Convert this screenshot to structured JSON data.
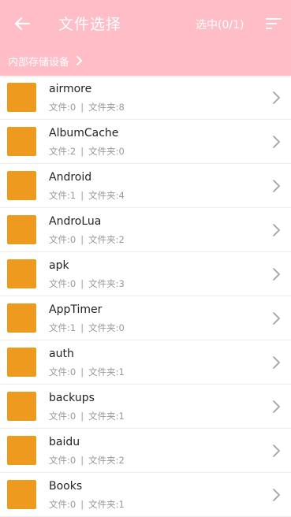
{
  "header": {
    "title": "文件选择",
    "selected": "选中(0/1)",
    "breadcrumb": "内部存储设备",
    "bg_color": "#ffbdc8"
  },
  "folders": [
    {
      "name": "airmore",
      "files_label": "文件:0",
      "sep": "|",
      "dirs_label": "文件夹:8"
    },
    {
      "name": "AlbumCache",
      "files_label": "文件:2",
      "sep": "|",
      "dirs_label": "文件夹:0"
    },
    {
      "name": "Android",
      "files_label": "文件:1",
      "sep": "|",
      "dirs_label": "文件夹:4"
    },
    {
      "name": "AndroLua",
      "files_label": "文件:0",
      "sep": "|",
      "dirs_label": "文件夹:2"
    },
    {
      "name": "apk",
      "files_label": "文件:0",
      "sep": "|",
      "dirs_label": "文件夹:3"
    },
    {
      "name": "AppTimer",
      "files_label": "文件:1",
      "sep": "|",
      "dirs_label": "文件夹:0"
    },
    {
      "name": "auth",
      "files_label": "文件:0",
      "sep": "|",
      "dirs_label": "文件夹:1"
    },
    {
      "name": "backups",
      "files_label": "文件:0",
      "sep": "|",
      "dirs_label": "文件夹:1"
    },
    {
      "name": "baidu",
      "files_label": "文件:0",
      "sep": "|",
      "dirs_label": "文件夹:2"
    },
    {
      "name": "Books",
      "files_label": "文件:0",
      "sep": "|",
      "dirs_label": "文件夹:1"
    }
  ],
  "icons": {
    "back": "arrow-left",
    "sort": "sort-lines",
    "breadcrumb_arrow": "chevron-right",
    "row_arrow": "chevron-right",
    "folder_color": "#ed9a1e"
  }
}
